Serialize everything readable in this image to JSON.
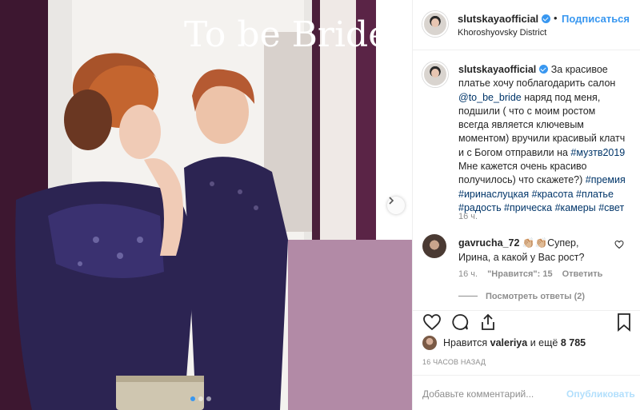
{
  "header": {
    "username": "slutskayaofficial",
    "separator": "•",
    "follow_label": "Подписаться",
    "location": "Khoroshyovsky District"
  },
  "photo": {
    "sign_text": "To be Bride"
  },
  "caption": {
    "username": "slutskayaofficial",
    "part1": "За красивое платье хочу поблагодарить салон ",
    "mention": "@to_be_bride",
    "part2": " наряд под меня, подшили ( что с моим ростом всегда является ключевым моментом) вручили красивый клатч и с Богом отправили на ",
    "tag1": "#музтв2019",
    "part3": " Мне кажется очень красиво получилось) что скажете?) ",
    "tags": "#премия #иринаслуцкая #красота #платье #радость #прическа #камеры #свет",
    "time": "16 ч."
  },
  "comment": {
    "username": "gavrucha_72",
    "emoji": "👏🏼👏🏼",
    "text": "Супер, Ирина, а какой у Вас рост?",
    "time": "16 ч.",
    "likes": "\"Нравится\": 15",
    "reply_label": "Ответить",
    "view_replies": "Посмотреть ответы (2)"
  },
  "likes": {
    "prefix": "Нравится ",
    "user": "valeriya",
    "middle": " и ещё ",
    "count": "8 785"
  },
  "post_time": "16 ЧАСОВ НАЗАД",
  "add_comment": {
    "placeholder": "Добавьте комментарий...",
    "publish_label": "Опубликовать"
  },
  "icons": [
    "heart-icon",
    "comment-icon",
    "share-icon",
    "bookmark-icon",
    "chevron-right-icon",
    "verified-icon"
  ],
  "colors": {
    "link": "#3897f0",
    "hashtag": "#003569",
    "muted": "#8e8e8e",
    "dress": "#2c2452"
  }
}
